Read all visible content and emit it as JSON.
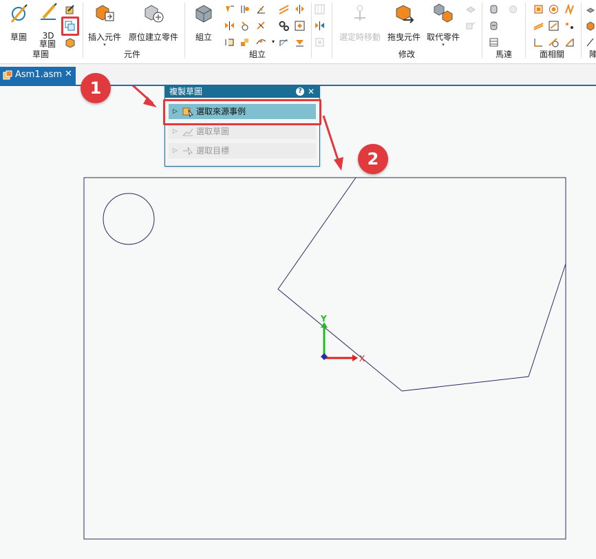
{
  "ribbon": {
    "sketch_label": "草圖",
    "sketch3d_label": "3D",
    "sketch3d_label2": "草圖",
    "group_sketch": "草圖",
    "insert_label": "插入元件",
    "inplace_label": "原位建立零件",
    "group_component": "元件",
    "assemble_label": "組立",
    "group_assemble": "組立",
    "move_label": "選定時移動",
    "drag_label": "拖曳元件",
    "replace_label": "取代零件",
    "group_modify": "修改",
    "group_motor": "馬達",
    "group_face": "面相關",
    "group_extra": "陣"
  },
  "tab": {
    "label": "Asm1.asm",
    "close": "✕"
  },
  "dialog": {
    "title": "複製草圖",
    "help": "?",
    "close": "✕",
    "steps": [
      {
        "label": "選取來源事例"
      },
      {
        "label": "選取草圖"
      },
      {
        "label": "選取目標"
      }
    ]
  },
  "callouts": {
    "one": "1",
    "two": "2"
  },
  "axes": {
    "x": "X",
    "y": "Y"
  },
  "colors": {
    "accent": "#1b6db0",
    "highlight": "#e03a3f",
    "sketch_line": "#2a2a66"
  }
}
